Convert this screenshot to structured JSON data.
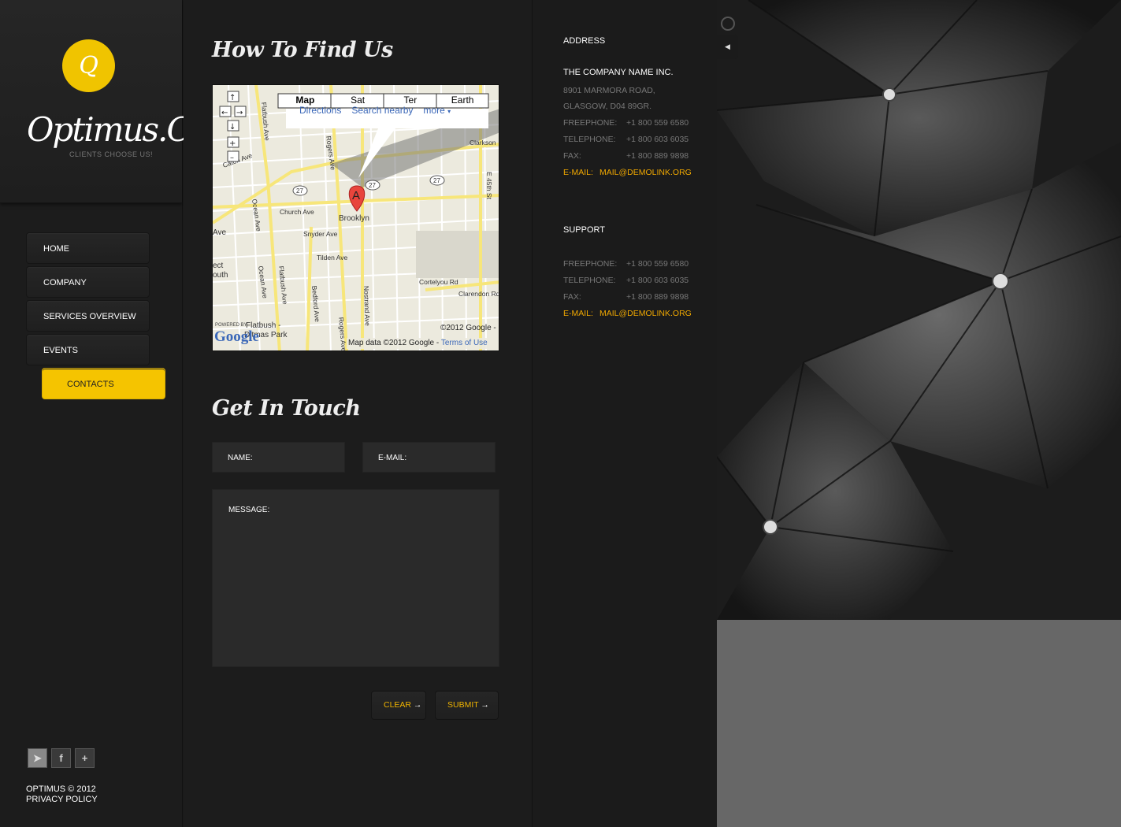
{
  "sidebar": {
    "logo_letter": "Q",
    "logo_text": "Optimus.Co",
    "tagline": "CLIENTS CHOOSE US!",
    "nav": [
      {
        "label": "HOME"
      },
      {
        "label": "COMPANY"
      },
      {
        "label": "SERVICES OVERVIEW"
      },
      {
        "label": "EVENTS"
      },
      {
        "label": "CONTACTS",
        "active": true
      }
    ],
    "social": [
      {
        "icon": "twitter-icon",
        "glyph": "🐦"
      },
      {
        "icon": "facebook-icon",
        "glyph": "f"
      },
      {
        "icon": "plus-icon",
        "glyph": "+"
      }
    ],
    "copyright": "OPTIMUS © 2012",
    "privacy": "PRIVACY POLICY"
  },
  "main": {
    "find_heading": "How To Find Us",
    "map": {
      "tabs": [
        "Map",
        "Sat",
        "Ter",
        "Earth"
      ],
      "links": [
        "Directions",
        "Search nearby",
        "more"
      ],
      "marker": "A",
      "streets": [
        "Flatbush Ave",
        "Rogers Ave",
        "Clarkson",
        "E 45th St",
        "Caton Ave",
        "Church Ave",
        "Ocean Ave",
        "Snyder Ave",
        "Tilden Ave",
        "Bedford Ave",
        "Nostrand Ave",
        "Cortelyou Rd",
        "Clarendon Rd",
        "Flatbush - Ditmas Park",
        "Brooklyn",
        "ect",
        "outh",
        "Ave"
      ],
      "routes": [
        "27",
        "27",
        "27"
      ],
      "attribution": "Map data ©2012 Google -",
      "terms": "Terms of Use",
      "copyright": "©2012 Google -",
      "powered": "POWERED BY",
      "google": "Google"
    },
    "touch_heading": "Get In Touch",
    "form": {
      "name_label": "NAME:",
      "email_label": "E-MAIL:",
      "message_label": "MESSAGE:",
      "clear": "CLEAR",
      "submit": "SUBMIT"
    }
  },
  "info": {
    "address_title": "ADDRESS",
    "company": "THE COMPANY NAME INC.",
    "street": "8901 MARMORA ROAD,",
    "city": "GLASGOW, D04 89GR.",
    "address_rows": [
      {
        "label": "FREEPHONE:",
        "value": "+1 800 559 6580"
      },
      {
        "label": "TELEPHONE:",
        "value": "+1 800 603 6035"
      },
      {
        "label": "FAX:",
        "value": "+1 800 889 9898"
      }
    ],
    "address_email_label": "E-MAIL:",
    "address_email": "MAIL@DEMOLINK.ORG",
    "support_title": "SUPPORT",
    "support_rows": [
      {
        "label": "FREEPHONE:",
        "value": "+1 800 559 6580"
      },
      {
        "label": "TELEPHONE:",
        "value": "+1 800 603 6035"
      },
      {
        "label": "FAX:",
        "value": "+1 800 889 9898"
      }
    ],
    "support_email_label": "E-MAIL:",
    "support_email": "MAIL@DEMOLINK.ORG"
  },
  "panel_toggle_icon": "collapse-arrow-icon",
  "colors": {
    "accent": "#f5c400",
    "link": "#f0a800",
    "background": "#1c1c1c"
  }
}
